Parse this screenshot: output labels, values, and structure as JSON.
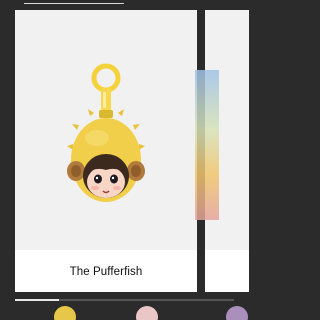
{
  "top": {
    "link_text": "~~~~~~~~~~~~~~~~~~~"
  },
  "carousel": {
    "items": [
      {
        "title": "The Pufferfish"
      }
    ]
  },
  "scroll_progress": 0.2,
  "colors": {
    "background": "#2b2b2c",
    "card": "#f1f1f1",
    "keyring": "#f5d13c",
    "pufferfish": "#f2cf4a"
  }
}
